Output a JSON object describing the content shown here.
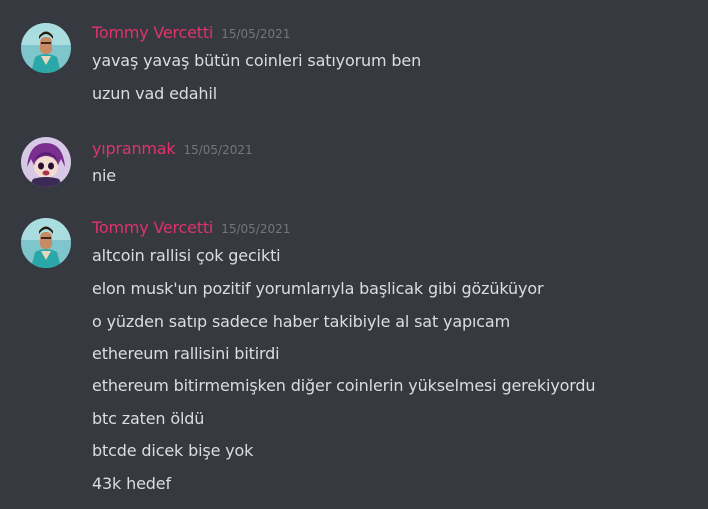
{
  "colors": {
    "background": "#36393f",
    "username": "#e0336b",
    "timestamp": "#72767d",
    "message_text": "#dcddde"
  },
  "messages": [
    {
      "author": "Tommy Vercetti",
      "timestamp": "15/05/2021",
      "avatar_icon": "tommy-vercetti-avatar",
      "lines": [
        "yavaş yavaş bütün coinleri satıyorum ben",
        "uzun vad edahil"
      ]
    },
    {
      "author": "yıpranmak",
      "timestamp": "15/05/2021",
      "avatar_icon": "anime-character-avatar",
      "lines": [
        "nie"
      ]
    },
    {
      "author": "Tommy Vercetti",
      "timestamp": "15/05/2021",
      "avatar_icon": "tommy-vercetti-avatar",
      "lines": [
        "altcoin rallisi çok gecikti",
        "elon musk'un pozitif yorumlarıyla başlicak gibi gözüküyor",
        "o yüzden satıp sadece haber takibiyle al sat yapıcam",
        "ethereum rallisini bitirdi",
        "ethereum bitirmemişken diğer coinlerin yükselmesi gerekiyordu",
        "btc zaten öldü",
        "btcde dicek bişe yok",
        "43k hedef"
      ]
    }
  ]
}
